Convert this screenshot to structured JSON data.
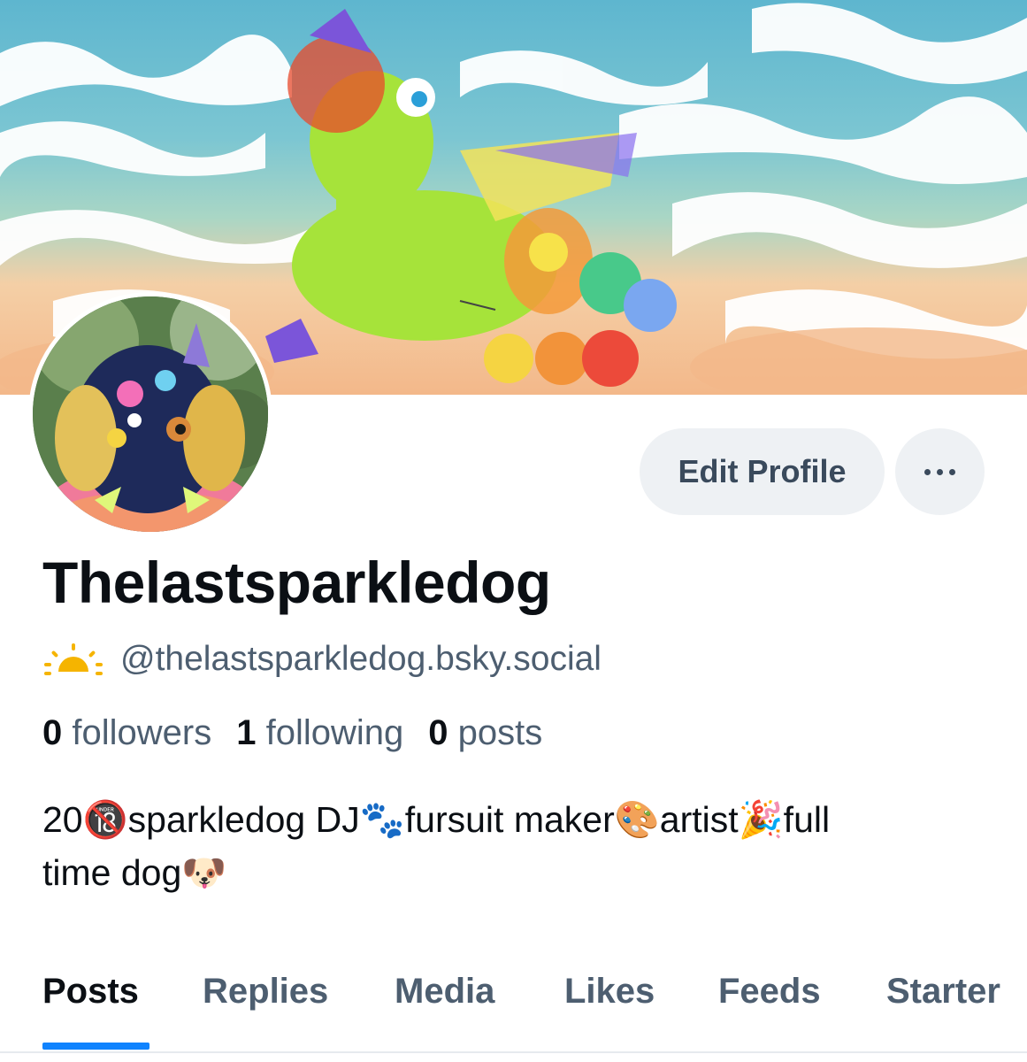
{
  "profile": {
    "display_name": "Thelastsparkledog",
    "handle": "@thelastsparkledog.bsky.social",
    "bio_line1": "20🔞sparkledog DJ🐾fursuit maker🎨artist🎉full",
    "bio_line2": "time dog🐶"
  },
  "actions": {
    "edit_profile_label": "Edit Profile",
    "more_icon": "ellipsis-icon"
  },
  "stats": {
    "followers_count": "0",
    "followers_label": "followers",
    "following_count": "1",
    "following_label": "following",
    "posts_count": "0",
    "posts_label": "posts"
  },
  "tabs": [
    {
      "label": "Posts",
      "active": true
    },
    {
      "label": "Replies",
      "active": false
    },
    {
      "label": "Media",
      "active": false
    },
    {
      "label": "Likes",
      "active": false
    },
    {
      "label": "Feeds",
      "active": false
    },
    {
      "label": "Starter",
      "active": false
    }
  ],
  "colors": {
    "accent": "#1083fe",
    "muted_text": "#4d5e70",
    "button_bg": "#eef1f4",
    "sun_icon": "#f5b400"
  }
}
